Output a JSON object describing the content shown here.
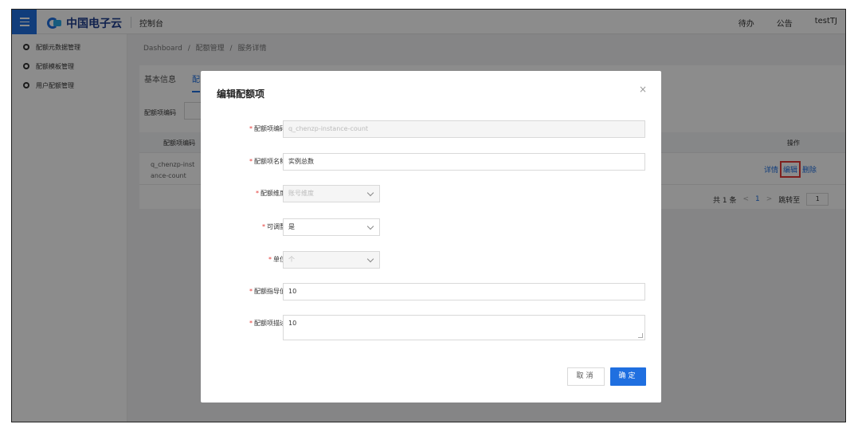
{
  "topbar": {
    "brand": "中国电子云",
    "console": "控制台",
    "todo": "待办",
    "notice": "公告",
    "user": "testTJ"
  },
  "sidebar": {
    "items": [
      {
        "label": "配额元数据管理",
        "icon": "gear-icon"
      },
      {
        "label": "配额模板管理",
        "icon": "gear-icon"
      },
      {
        "label": "用户配额管理",
        "icon": "gear-icon"
      }
    ]
  },
  "breadcrumb": {
    "items": [
      "Dashboard",
      "/",
      "配额管理",
      "/",
      "服务详情"
    ]
  },
  "page": {
    "tabs": [
      "基本信息",
      "配"
    ],
    "filter_label": "配额项编码",
    "table": {
      "headers": {
        "code": "配额项编码",
        "ops": "操作"
      },
      "row": {
        "code": "q_chenzp-instance-count",
        "code_line1": "q_chenzp-inst",
        "code_line2": "ance-count"
      },
      "ops": {
        "detail": "详情",
        "edit": "编辑",
        "delete": "删除"
      }
    },
    "pager": {
      "total": "共 1 条",
      "prev": "<",
      "current": "1",
      "next": ">",
      "jump_label": "跳转至",
      "jump_value": "1"
    }
  },
  "modal": {
    "title": "编辑配额项",
    "close": "×",
    "fields": {
      "code": {
        "label": "配额项编码",
        "value": "q_chenzp-instance-count"
      },
      "name": {
        "label": "配额项名称",
        "value": "实例总数"
      },
      "dimension": {
        "label": "配额维度",
        "value": "账号维度"
      },
      "adjustable": {
        "label": "可调整",
        "value": "是"
      },
      "unit": {
        "label": "单位",
        "value": "个"
      },
      "guide": {
        "label": "配额指导值",
        "value": "10"
      },
      "desc": {
        "label": "配额项描述",
        "value": "10"
      }
    },
    "required_mark": "*",
    "cancel": "取消",
    "confirm": "确定"
  },
  "colors": {
    "primary": "#1f6fe0",
    "highlight": "#e53935",
    "mask": "rgba(0,0,0,0.45)"
  }
}
